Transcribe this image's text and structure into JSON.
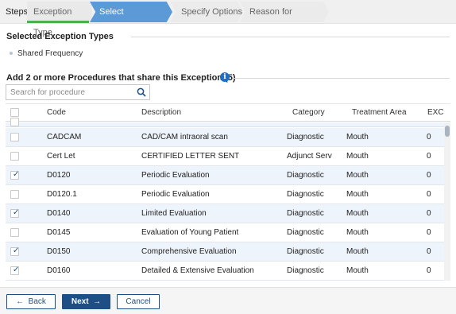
{
  "steps": {
    "label": "Steps",
    "items": [
      "Exception Type",
      "Select Procedure(s)",
      "Specify Options",
      "Reason for Exception"
    ]
  },
  "selected_types": {
    "title": "Selected Exception Types",
    "items": [
      "Shared Frequency"
    ]
  },
  "procedures": {
    "title": "Add 2 or more Procedures that share this Exception (5)",
    "search_placeholder": "Search for procedure",
    "columns": [
      "Code",
      "Description",
      "Category",
      "Treatment Area",
      "EXC"
    ],
    "rows": [
      {
        "code": "CADCAM",
        "description": "CAD/CAM intraoral scan",
        "category": "Diagnostic",
        "area": "Mouth",
        "exc": "0",
        "checked": false
      },
      {
        "code": "Cert Let",
        "description": "CERTIFIED LETTER SENT",
        "category": "Adjunct Serv",
        "area": "Mouth",
        "exc": "0",
        "checked": false
      },
      {
        "code": "D0120",
        "description": "Periodic Evaluation",
        "category": "Diagnostic",
        "area": "Mouth",
        "exc": "0",
        "checked": true
      },
      {
        "code": "D0120.1",
        "description": "Periodic Evaluation",
        "category": "Diagnostic",
        "area": "Mouth",
        "exc": "0",
        "checked": false
      },
      {
        "code": "D0140",
        "description": "Limited Evaluation",
        "category": "Diagnostic",
        "area": "Mouth",
        "exc": "0",
        "checked": true
      },
      {
        "code": "D0145",
        "description": "Evaluation of Young Patient",
        "category": "Diagnostic",
        "area": "Mouth",
        "exc": "0",
        "checked": false
      },
      {
        "code": "D0150",
        "description": "Comprehensive Evaluation",
        "category": "Diagnostic",
        "area": "Mouth",
        "exc": "0",
        "checked": true
      },
      {
        "code": "D0160",
        "description": "Detailed & Extensive Evaluation",
        "category": "Diagnostic",
        "area": "Mouth",
        "exc": "0",
        "checked": true
      }
    ]
  },
  "footer": {
    "back_label": "Back",
    "next_label": "Next",
    "cancel_label": "Cancel"
  },
  "colors": {
    "active_step": "#5b9ad6",
    "completed_step_bar": "#4caf50",
    "primary_button": "#1f4e85",
    "row_alt": "#eef4fc"
  },
  "icons": {
    "info": "info-circle-icon",
    "search": "search-icon",
    "back": "arrow-left-icon",
    "next": "arrow-right-icon",
    "checkbox": "checkmark-icon"
  }
}
